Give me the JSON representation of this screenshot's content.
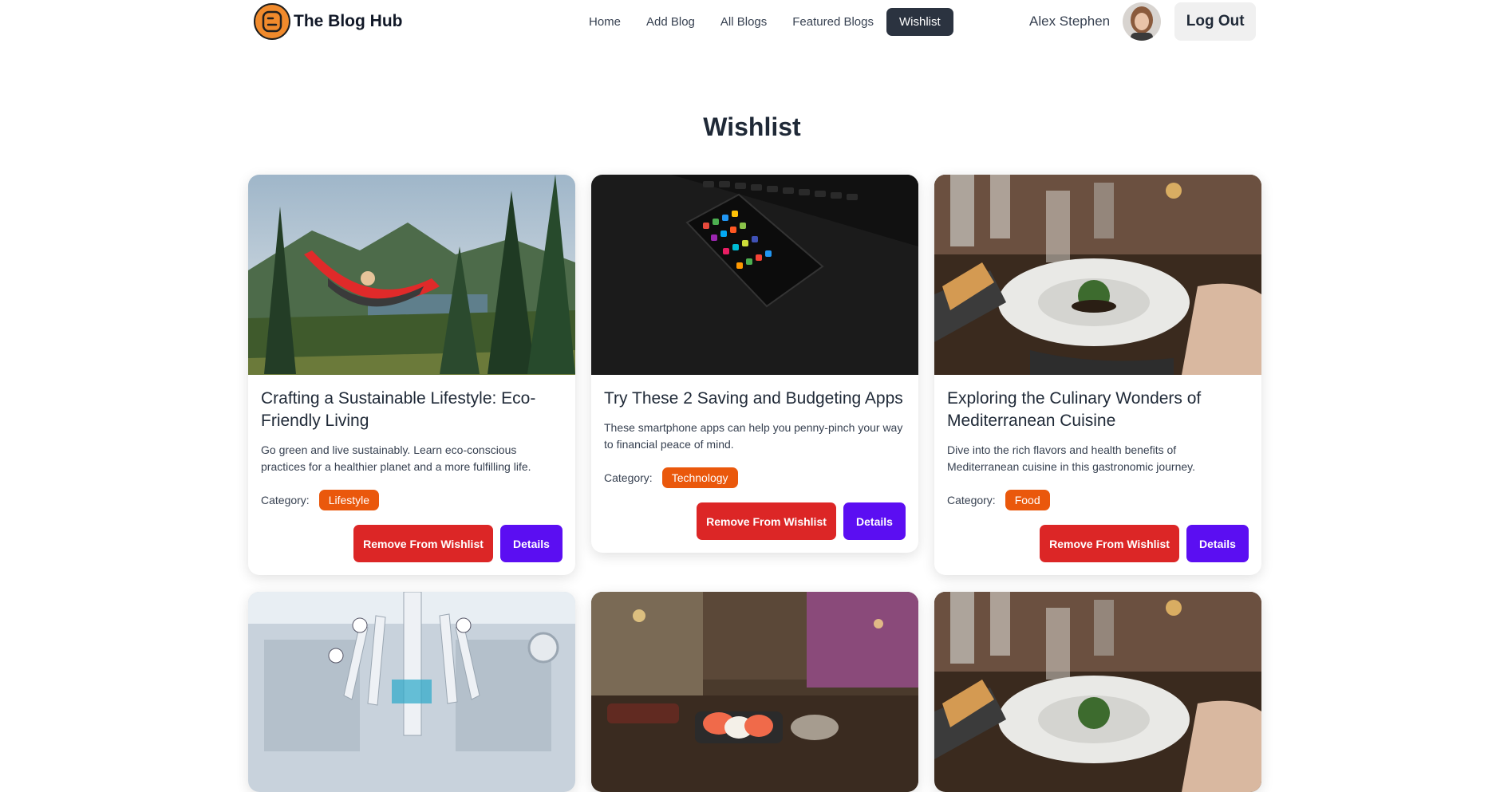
{
  "nav": {
    "brand": "The Blog Hub",
    "links": [
      "Home",
      "Add Blog",
      "All Blogs",
      "Featured Blogs",
      "Wishlist"
    ],
    "active": "Wishlist",
    "user_name": "Alex Stephen",
    "logout_label": "Log Out"
  },
  "page": {
    "title": "Wishlist"
  },
  "labels": {
    "category": "Category:",
    "remove": "Remove From Wishlist",
    "details": "Details"
  },
  "cards": [
    {
      "title": "Crafting a Sustainable Lifestyle: Eco-Friendly Living",
      "description": "Go green and live sustainably. Learn eco-conscious practices for a healthier planet and a more fulfilling life.",
      "category": "Lifestyle",
      "image": "hammock-forest-photo"
    },
    {
      "title": "Try These 2 Saving and Budgeting Apps",
      "description": "These smartphone apps can help you penny-pinch your way to financial peace of mind.",
      "category": "Technology",
      "image": "smartphone-dark-photo"
    },
    {
      "title": "Exploring the Culinary Wonders of Mediterranean Cuisine",
      "description": "Dive into the rich flavors and health benefits of Mediterranean cuisine in this gastronomic journey.",
      "category": "Food",
      "image": "dinner-plate-photo"
    },
    {
      "image": "surgical-robot-photo"
    },
    {
      "image": "sushi-restaurant-photo"
    },
    {
      "image": "dinner-plate-photo"
    }
  ]
}
